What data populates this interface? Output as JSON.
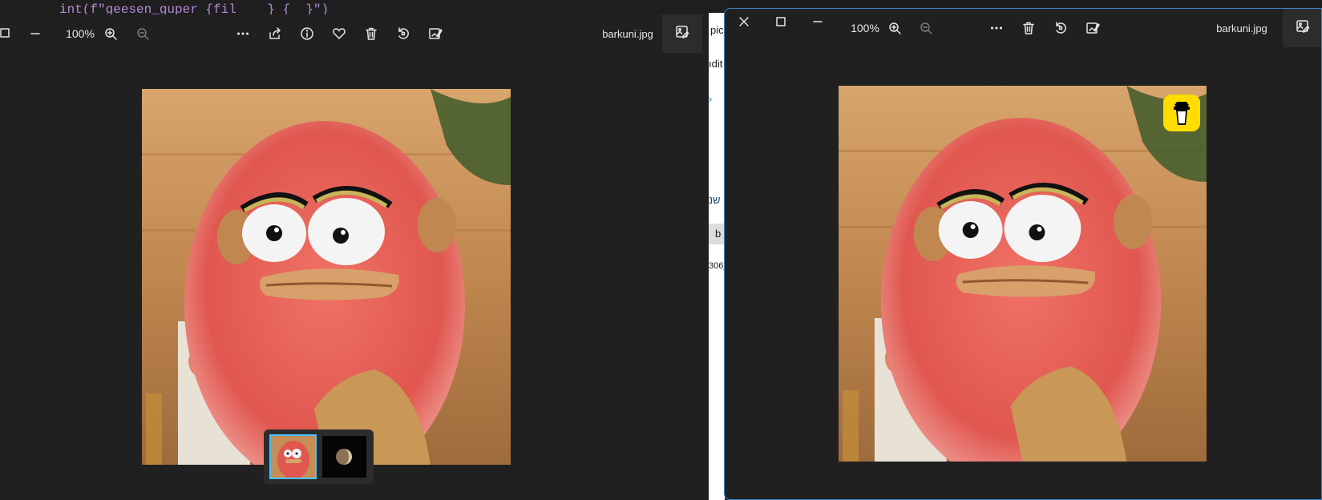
{
  "background": {
    "code_line": "int(f\"geesen_guper {fil    } {  }\")",
    "other_app_snippets": [
      "pic",
      "ıdit",
      "›",
      "שנ",
      "b",
      "306_"
    ]
  },
  "left_window": {
    "zoom": "100%",
    "filename": "barkuni.jpg",
    "toolbar_icons": [
      "minimize-icon",
      "zoom-in-icon",
      "zoom-out-icon",
      "more-icon",
      "share-icon",
      "info-icon",
      "favorite-icon",
      "delete-icon",
      "rotate-icon",
      "edit-icon",
      "edit-image-icon"
    ],
    "filmstrip": [
      {
        "name": "barkuni-thumbnail",
        "selected": true
      },
      {
        "name": "moon-thumbnail",
        "selected": false
      }
    ]
  },
  "right_window": {
    "zoom": "100%",
    "filename": "barkuni.jpg",
    "toolbar_icons": [
      "close-icon",
      "maximize-icon",
      "minimize-icon",
      "zoom-in-icon",
      "zoom-out-icon",
      "more-icon",
      "delete-icon",
      "rotate-icon",
      "edit-icon",
      "edit-image-icon"
    ],
    "overlay_icon": "cup-icon"
  },
  "colors": {
    "window_bg": "#202020",
    "accent": "#3b82c4",
    "selection": "#4cc2ff",
    "badge": "#ffdd00"
  }
}
